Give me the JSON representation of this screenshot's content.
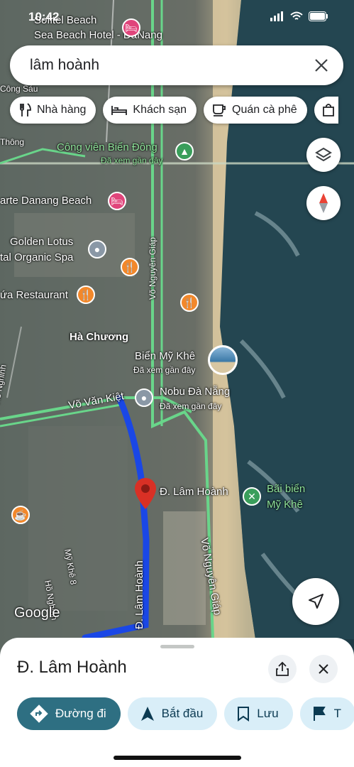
{
  "status_bar": {
    "time": "10:42"
  },
  "search": {
    "query": "lâm hoành"
  },
  "chips": [
    {
      "label": "Nhà hàng",
      "icon": "fork-knife-icon"
    },
    {
      "label": "Khách sạn",
      "icon": "bed-icon"
    },
    {
      "label": "Quán cà phê",
      "icon": "coffee-cup-icon"
    },
    {
      "label": "",
      "icon": "shopping-bag-icon"
    }
  ],
  "map": {
    "labels": {
      "hotel_top": "Sea Beach Hotel - DaNang",
      "hotel_top_prefix": "Sofitel Beach",
      "cong_sau": "Công Sáu",
      "thong": "Thông",
      "park": "Công viên Biển Đông",
      "park_sub": "Đã xem gần đây",
      "carte": "arte Danang Beach",
      "golden": "Golden Lotus",
      "organic": "tal Organic Spa",
      "restaurant": "ứa Restaurant",
      "ha_chuong": "Hà Chương",
      "bien_my_khe": "Biển Mỹ Khê",
      "bien_my_khe_sub": "Đã xem gần đây",
      "nobu": "Nobu Đà Nẵng",
      "nobu_sub": "Đã xem gần đây",
      "vo_van_kiet": "Võ Văn Kiệt",
      "lam_hoanh_label": "Đ. Lâm Hoành",
      "bai_bien": "Bãi biển",
      "bai_bien_2": "Mỹ Khê",
      "ho_nghinh": "Hồ Nghinh",
      "ho_nghinh_2": "Hồ Nghinh",
      "my_khe_8": "Mỹ Khê 8",
      "road_vertical": "Đ. Lâm Hoành",
      "vo_nguyen_giap": "Võ Nguyên Giáp",
      "vo_nguyen_giap_2": "Võ Nguyên Giáp",
      "google": "Google"
    },
    "route_color": "#1a47e6",
    "pin_color": "#d93025"
  },
  "sheet": {
    "title": "Đ. Lâm Hoành",
    "actions": [
      {
        "label": "Đường đi",
        "icon": "directions-icon"
      },
      {
        "label": "Bắt đầu",
        "icon": "navigation-arrow-icon"
      },
      {
        "label": "Lưu",
        "icon": "bookmark-icon"
      },
      {
        "label": "T",
        "icon": "flag-icon"
      }
    ]
  }
}
